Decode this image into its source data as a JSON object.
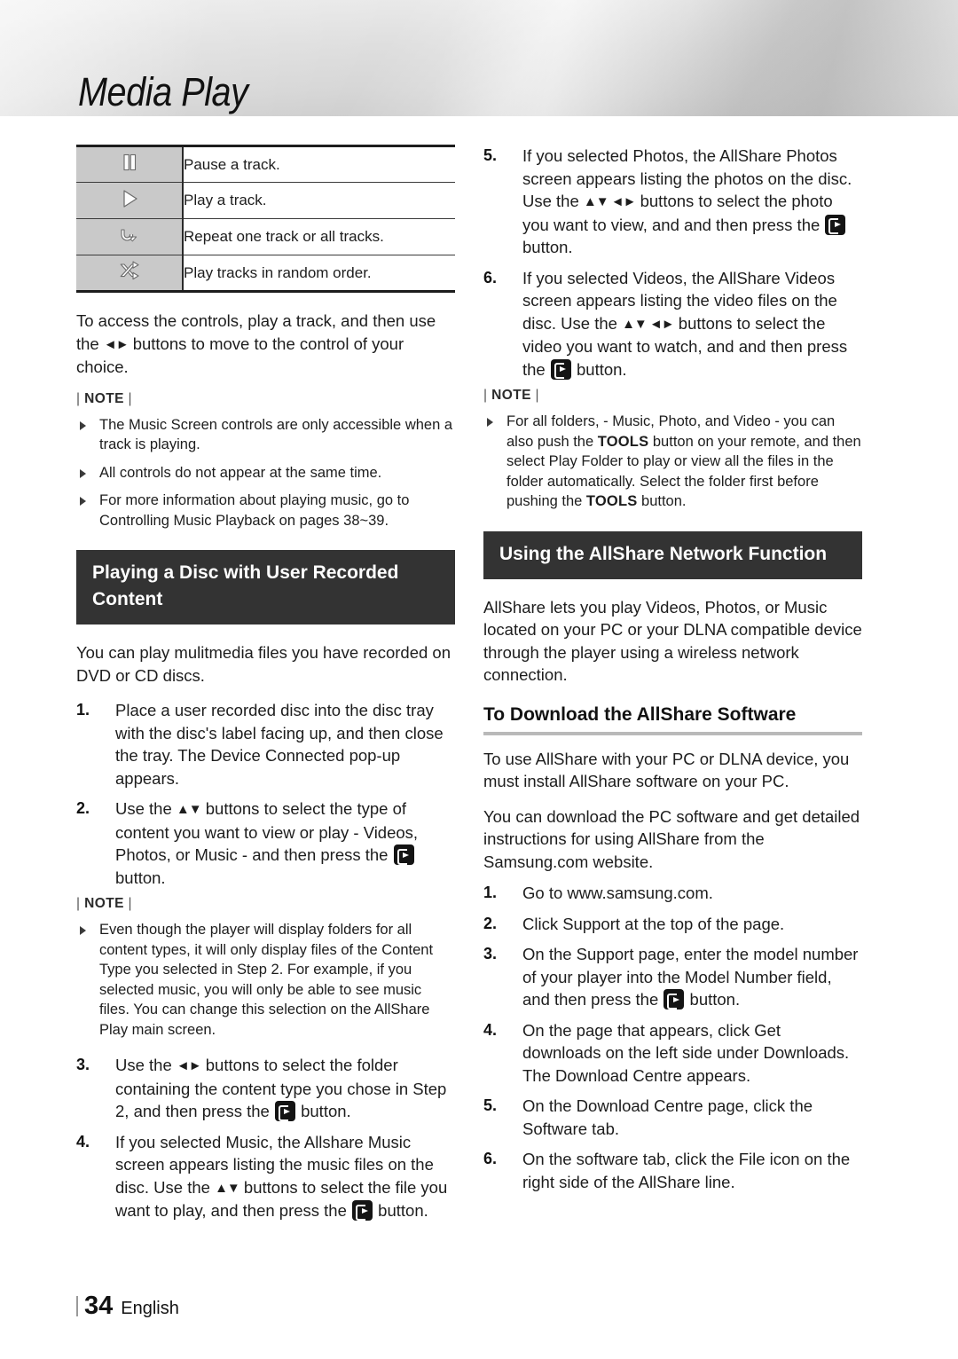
{
  "header": {
    "chapter_title": "Media Play"
  },
  "left_column": {
    "control_table": {
      "rows": [
        {
          "icon": "pause-icon",
          "description": "Pause a track."
        },
        {
          "icon": "play-icon",
          "description": "Play a track."
        },
        {
          "icon": "repeat-icon",
          "description": "Repeat one track or all tracks."
        },
        {
          "icon": "shuffle-icon",
          "description": "Play tracks in random order."
        }
      ]
    },
    "intro_paragraph_1": "To access the controls, play a track, and then use the ",
    "intro_paragraph_2": " buttons to move to the control of your choice.",
    "note_label": "NOTE",
    "notes": [
      "The Music Screen controls are only accessible when a track is playing.",
      "All controls do not appear at the same time.",
      "For more information about playing music, go to Controlling Music Playback on pages 38~39."
    ],
    "section_header": "Playing a Disc with User Recorded Content",
    "section_intro": "You can play mulitmedia files you have recorded on DVD or CD discs.",
    "steps_part1": [
      {
        "num": "1.",
        "text": "Place a user recorded disc into the disc tray with the disc's label facing up, and then close the tray. The Device Connected pop-up appears."
      },
      {
        "num": "2.",
        "pre": "Use the ",
        "arrows": "▲▼",
        "mid": " buttons to select the type of content you want to view or play - Videos, Photos, or Music - and then press the ",
        "post": " button."
      }
    ],
    "note_label_2": "NOTE",
    "notes_2": [
      "Even though the player will display folders for all content types, it will only display files of the Content Type you selected in Step 2. For example, if you selected music, you will only be able to see music files. You can change this selection on the AllShare Play main screen."
    ],
    "steps_part2": [
      {
        "num": "3.",
        "pre": "Use the ",
        "arrows": "◄►",
        "mid": " buttons to select the folder containing the content type you chose in Step 2, and then press the ",
        "post": " button."
      },
      {
        "num": "4.",
        "pre": "If you selected Music, the Allshare Music screen appears listing the music files on the disc. Use the ",
        "arrows": "▲▼",
        "mid": " buttons to select the file you want to play, and then press the ",
        "post": " button."
      }
    ]
  },
  "right_column": {
    "steps_top": [
      {
        "num": "5.",
        "pre": "If you selected Photos, the AllShare Photos screen appears listing the photos on the disc. Use the ",
        "arrows": "▲▼ ◄►",
        "mid": " buttons to select the photo you want to view, and and then press the ",
        "post": " button."
      },
      {
        "num": "6.",
        "pre": "If you selected Videos, the AllShare Videos screen appears listing the video files on the disc. Use the ",
        "arrows": "▲▼ ◄►",
        "mid": " buttons to select the video you want to watch, and and then press the ",
        "post": " button."
      }
    ],
    "note_label": "NOTE",
    "note_tools": {
      "part1": "For all folders, - Music, Photo, and Video - you can also push the ",
      "kbd1": "TOOLS",
      "part2": " button on your remote, and then select Play Folder to play or view all the files in the folder automatically. Select the folder first before pushing the ",
      "kbd2": "TOOLS",
      "part3": " button."
    },
    "section_header": "Using the AllShare Network Function",
    "section_intro": "AllShare lets you play Videos, Photos, or Music located on your PC or your DLNA compatible device through the player using a wireless network connection.",
    "sub_head": "To Download the AllShare Software",
    "paragraph_1": "To use AllShare with your PC or DLNA device, you must install AllShare software on your PC.",
    "paragraph_2": "You can download the PC software and get detailed instructions for using AllShare from the Samsung.com website.",
    "steps": [
      {
        "num": "1.",
        "text": "Go to www.samsung.com."
      },
      {
        "num": "2.",
        "text": "Click Support at the top of the page."
      },
      {
        "num": "3.",
        "pre": "On the Support page, enter the model number of your player into the Model Number field, and then press the ",
        "post": " button."
      },
      {
        "num": "4.",
        "text": "On the page that appears, click Get downloads on the left side under Downloads. The Download Centre appears."
      },
      {
        "num": "5.",
        "text": "On the Download Centre page, click the Software tab."
      },
      {
        "num": "6.",
        "text": "On the software tab, click the File icon on the right side of the AllShare line."
      }
    ]
  },
  "footer": {
    "page_number": "34",
    "language": "English"
  }
}
